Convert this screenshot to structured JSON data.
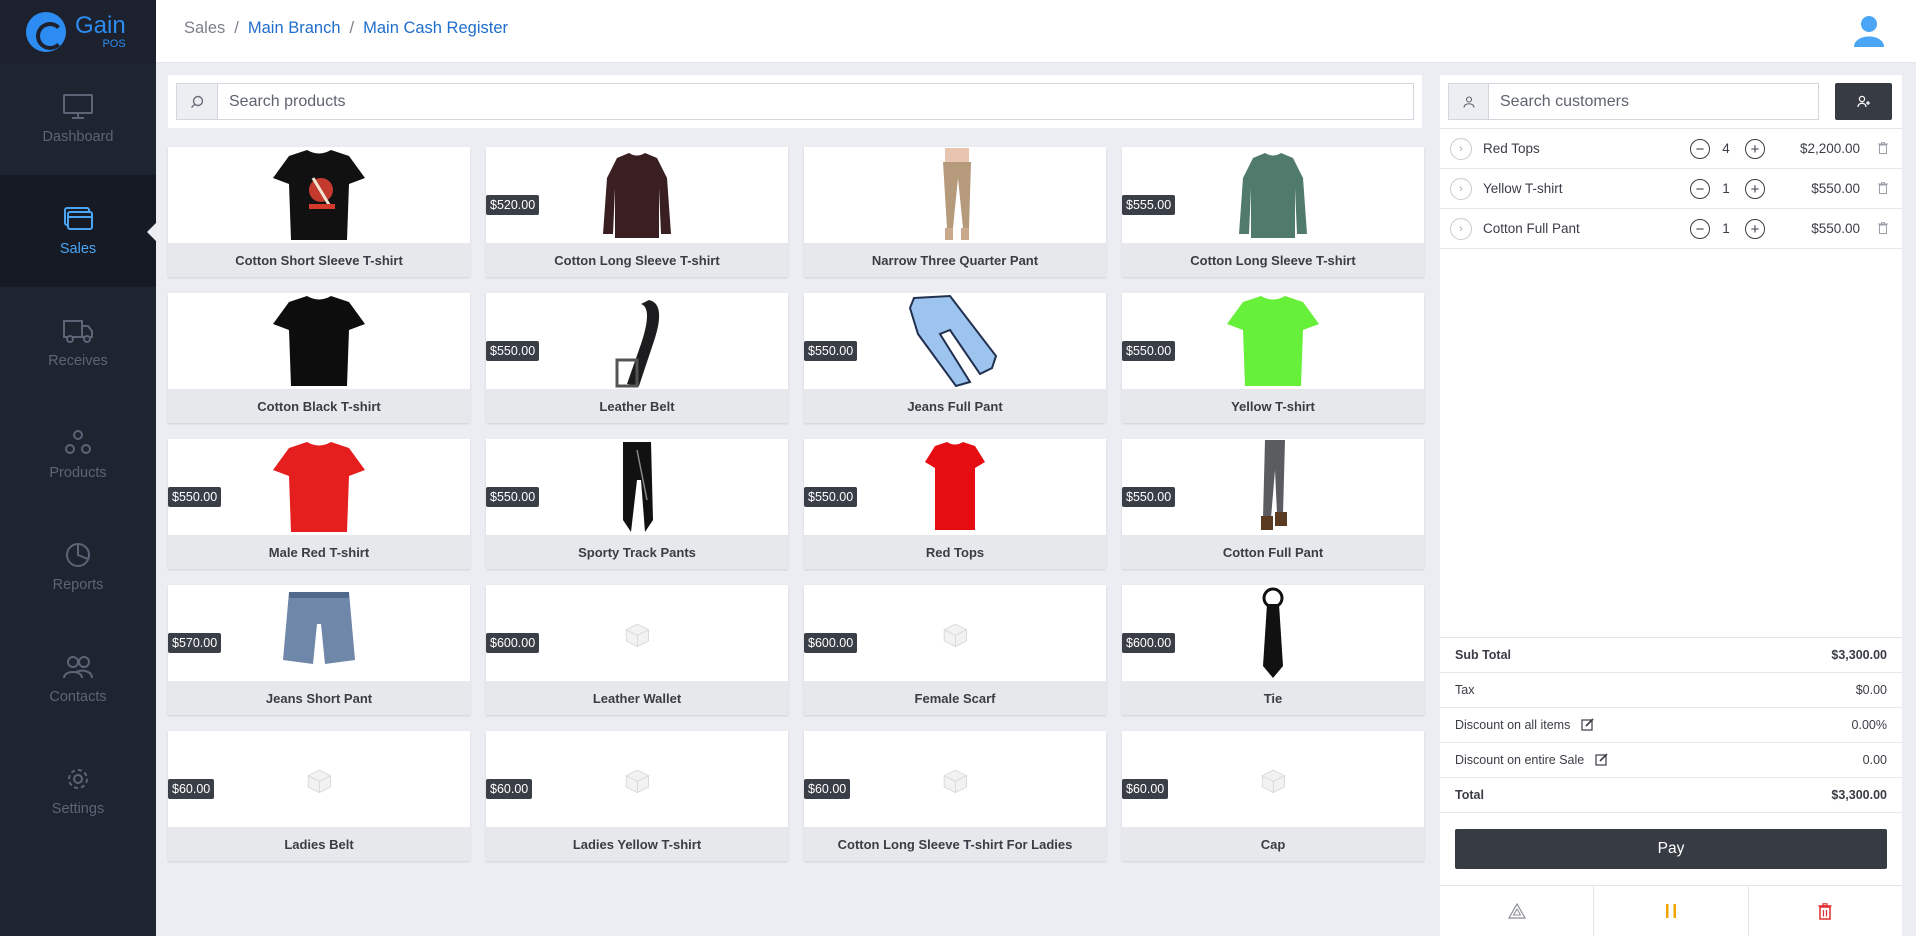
{
  "app": {
    "name": "Gain",
    "sub": "POS"
  },
  "sidebar": {
    "items": [
      {
        "label": "Dashboard",
        "icon": "monitor-icon"
      },
      {
        "label": "Sales",
        "icon": "cards-icon"
      },
      {
        "label": "Receives",
        "icon": "truck-icon"
      },
      {
        "label": "Products",
        "icon": "triangle-icon"
      },
      {
        "label": "Reports",
        "icon": "pie-chart-icon"
      },
      {
        "label": "Contacts",
        "icon": "users-icon"
      },
      {
        "label": "Settings",
        "icon": "gear-icon"
      }
    ],
    "active": "Sales"
  },
  "breadcrumb": [
    "Sales",
    "Main Branch",
    "Main Cash Register"
  ],
  "products": {
    "search_placeholder": "Search products",
    "items": [
      {
        "name": "Cotton Short Sleeve T-shirt",
        "price": "",
        "img": "tshirt-black-print"
      },
      {
        "name": "Cotton Long Sleeve T-shirt",
        "price": "$520.00",
        "img": "longsleeve-maroon"
      },
      {
        "name": "Narrow Three Quarter Pant",
        "price": "",
        "img": "pant-beige"
      },
      {
        "name": "Cotton Long Sleeve T-shirt",
        "price": "$555.00",
        "img": "longsleeve-teal"
      },
      {
        "name": "Cotton Black T-shirt",
        "price": "",
        "img": "tshirt-black"
      },
      {
        "name": "Leather Belt",
        "price": "$550.00",
        "img": "belt"
      },
      {
        "name": "Jeans Full Pant",
        "price": "$550.00",
        "img": "jeans"
      },
      {
        "name": "Yellow T-shirt",
        "price": "$550.00",
        "img": "tshirt-green"
      },
      {
        "name": "Male Red T-shirt",
        "price": "$550.00",
        "img": "tshirt-red"
      },
      {
        "name": "Sporty Track Pants",
        "price": "$550.00",
        "img": "track-pants"
      },
      {
        "name": "Red Tops",
        "price": "$550.00",
        "img": "red-top"
      },
      {
        "name": "Cotton Full Pant",
        "price": "$550.00",
        "img": "pant-grey"
      },
      {
        "name": "Jeans Short Pant",
        "price": "$570.00",
        "img": "jeans-short"
      },
      {
        "name": "Leather Wallet",
        "price": "$600.00",
        "img": "placeholder"
      },
      {
        "name": "Female Scarf",
        "price": "$600.00",
        "img": "placeholder"
      },
      {
        "name": "Tie",
        "price": "$600.00",
        "img": "tie"
      },
      {
        "name": "Ladies Belt",
        "price": "$60.00",
        "img": "placeholder"
      },
      {
        "name": "Ladies Yellow T-shirt",
        "price": "$60.00",
        "img": "placeholder"
      },
      {
        "name": "Cotton Long Sleeve T-shirt For Ladies",
        "price": "$60.00",
        "img": "placeholder"
      },
      {
        "name": "Cap",
        "price": "$60.00",
        "img": "placeholder"
      }
    ]
  },
  "cart": {
    "customer_placeholder": "Search customers",
    "items": [
      {
        "name": "Red Tops",
        "qty": "4",
        "price": "$2,200.00"
      },
      {
        "name": "Yellow T-shirt",
        "qty": "1",
        "price": "$550.00"
      },
      {
        "name": "Cotton Full Pant",
        "qty": "1",
        "price": "$550.00"
      }
    ],
    "totals": {
      "subtotal_label": "Sub Total",
      "subtotal": "$3,300.00",
      "tax_label": "Tax",
      "tax": "$0.00",
      "discount_items_label": "Discount on all items",
      "discount_items": "0.00%",
      "discount_sale_label": "Discount on entire Sale",
      "discount_sale": "0.00",
      "total_label": "Total",
      "total": "$3,300.00"
    },
    "pay_label": "Pay"
  },
  "colors": {
    "accent": "#2c8cf2",
    "sidebar": "#1f2431",
    "dark_button": "#373b44",
    "hold": "#f0a500",
    "delete": "#e02d2d"
  }
}
